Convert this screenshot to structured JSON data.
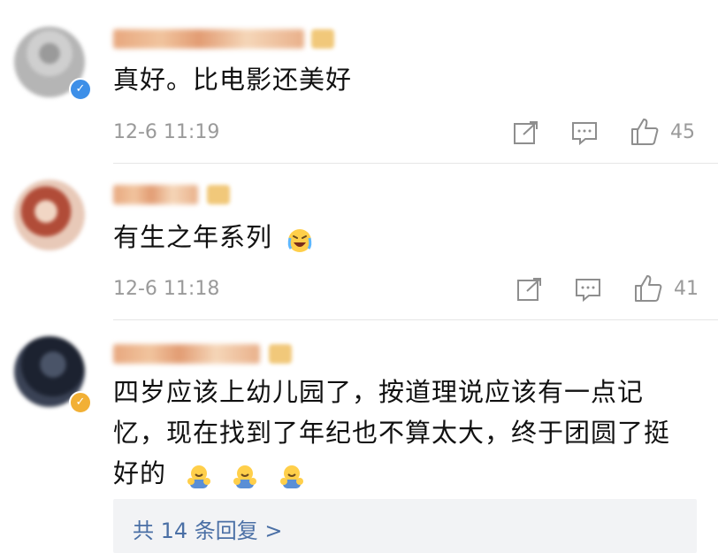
{
  "comments": [
    {
      "text": "真好。比电影还美好",
      "time": "12-6 11:19",
      "likes": "45",
      "verified": "blue"
    },
    {
      "text": "有生之年系列",
      "time": "12-6 11:18",
      "likes": "41",
      "emoji": "laughing-crying-emoji"
    },
    {
      "text_line1": "四岁应该上幼儿园了，按道理说应该有一点记",
      "text_line2": "忆，现在找到了年纪也不算太大，终于团圆了挺",
      "text_line3": "好的",
      "verified": "gold",
      "emoji": "hug-emoji",
      "emoji_count": 3
    }
  ],
  "replies": {
    "label": "共 14 条回复 >"
  },
  "colors": {
    "meta_gray": "#9a9a9a",
    "link_blue": "#4a6fa5",
    "verify_blue": "#3d8fe8",
    "verify_gold": "#f2b035",
    "reply_bg": "#f2f3f5"
  }
}
